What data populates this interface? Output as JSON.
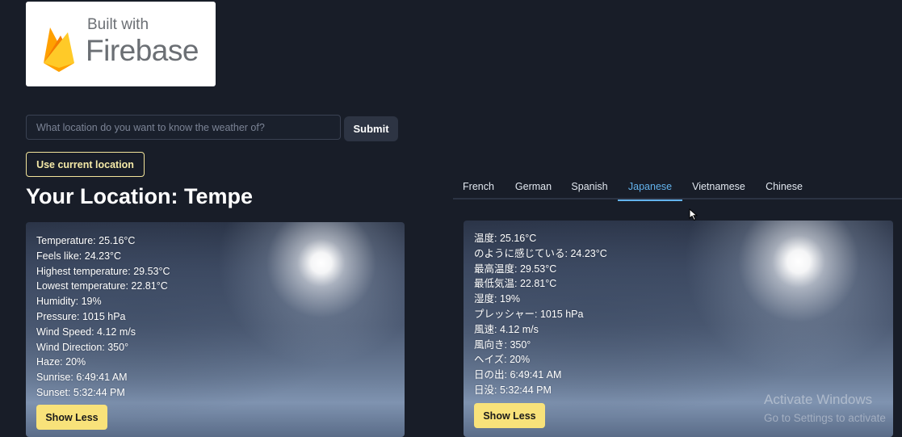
{
  "badge": {
    "line1": "Built with",
    "line2": "Firebase",
    "icon": "firebase-flame-icon"
  },
  "search": {
    "placeholder": "What location do you want to know the weather of?",
    "value": "",
    "submit_label": "Submit"
  },
  "use_location_label": "Use current location",
  "title": "Your Location: Tempe",
  "english": {
    "stats": [
      "Temperature: 25.16°C",
      "Feels like: 24.23°C",
      "Highest temperature: 29.53°C",
      "Lowest temperature: 22.81°C",
      "Humidity: 19%",
      "Pressure: 1015 hPa",
      "Wind Speed: 4.12 m/s",
      "Wind Direction: 350°",
      "Haze: 20%",
      "Sunrise: 6:49:41 AM",
      "Sunset: 5:32:44 PM"
    ],
    "button": "Show Less"
  },
  "tabs": {
    "items": [
      "French",
      "German",
      "Spanish",
      "Japanese",
      "Vietnamese",
      "Chinese"
    ],
    "active": "Japanese"
  },
  "japanese": {
    "stats": [
      "温度: 25.16°C",
      "のように感じている: 24.23°C",
      "最高温度: 29.53°C",
      "最低気温: 22.81°C",
      "湿度: 19%",
      "プレッシャー: 1015 hPa",
      "風速: 4.12 m/s",
      "風向き: 350°",
      "ヘイズ: 20%",
      "日の出: 6:49:41 AM",
      "日没: 5:32:44 PM"
    ],
    "button": "Show Less"
  },
  "watermark": {
    "line1": "Activate Windows",
    "line2": "Go to Settings to activate"
  },
  "colors": {
    "background": "#181d28",
    "accent_tab": "#63b3ed",
    "show_less_button": "#f8e27a",
    "location_button_border": "#f2e49a"
  }
}
